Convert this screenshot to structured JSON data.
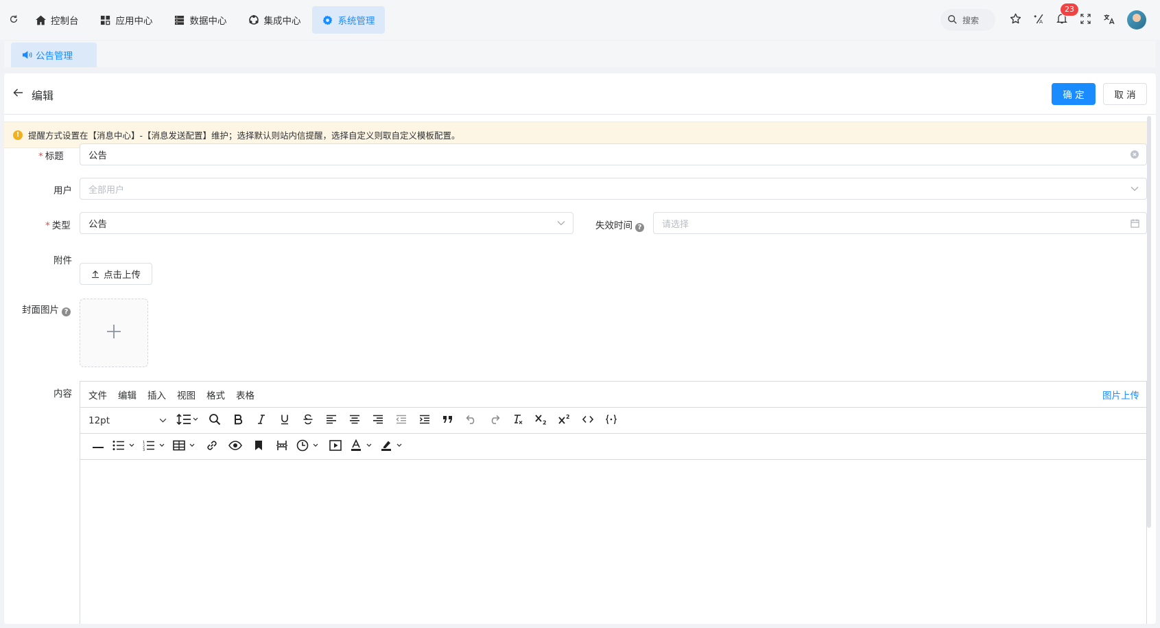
{
  "topnav": {
    "items": [
      {
        "label": "控制台",
        "icon": "home-icon"
      },
      {
        "label": "应用中心",
        "icon": "apps-icon"
      },
      {
        "label": "数据中心",
        "icon": "database-icon"
      },
      {
        "label": "集成中心",
        "icon": "integration-icon"
      },
      {
        "label": "系统管理",
        "icon": "gear-icon",
        "active": true
      }
    ],
    "search_label": "搜索",
    "notification_count": "23"
  },
  "tabs": [
    {
      "label": "公告管理",
      "icon": "megaphone-icon"
    }
  ],
  "page": {
    "title": "编辑",
    "confirm_label": "确 定",
    "cancel_label": "取 消"
  },
  "notice": {
    "text": "提醒方式设置在【消息中心】-【消息发送配置】维护；选择默认则站内信提醒，选择自定义则取自定义模板配置。"
  },
  "form": {
    "title_label": "标题",
    "title_value": "公告",
    "user_label": "用户",
    "user_placeholder": "全部用户",
    "type_label": "类型",
    "type_value": "公告",
    "expire_label": "失效时间",
    "expire_placeholder": "请选择",
    "attachment_label": "附件",
    "upload_label": "点击上传",
    "cover_label": "封面图片",
    "content_label": "内容"
  },
  "editor": {
    "menus": [
      "文件",
      "编辑",
      "插入",
      "视图",
      "格式",
      "表格"
    ],
    "image_upload_label": "图片上传",
    "font_size": "12pt"
  },
  "colors": {
    "primary": "#1a8cff",
    "active_bg": "#dce9f9",
    "required": "#f04343",
    "notice_bg": "#fdf6e4",
    "badge": "#f04343"
  }
}
